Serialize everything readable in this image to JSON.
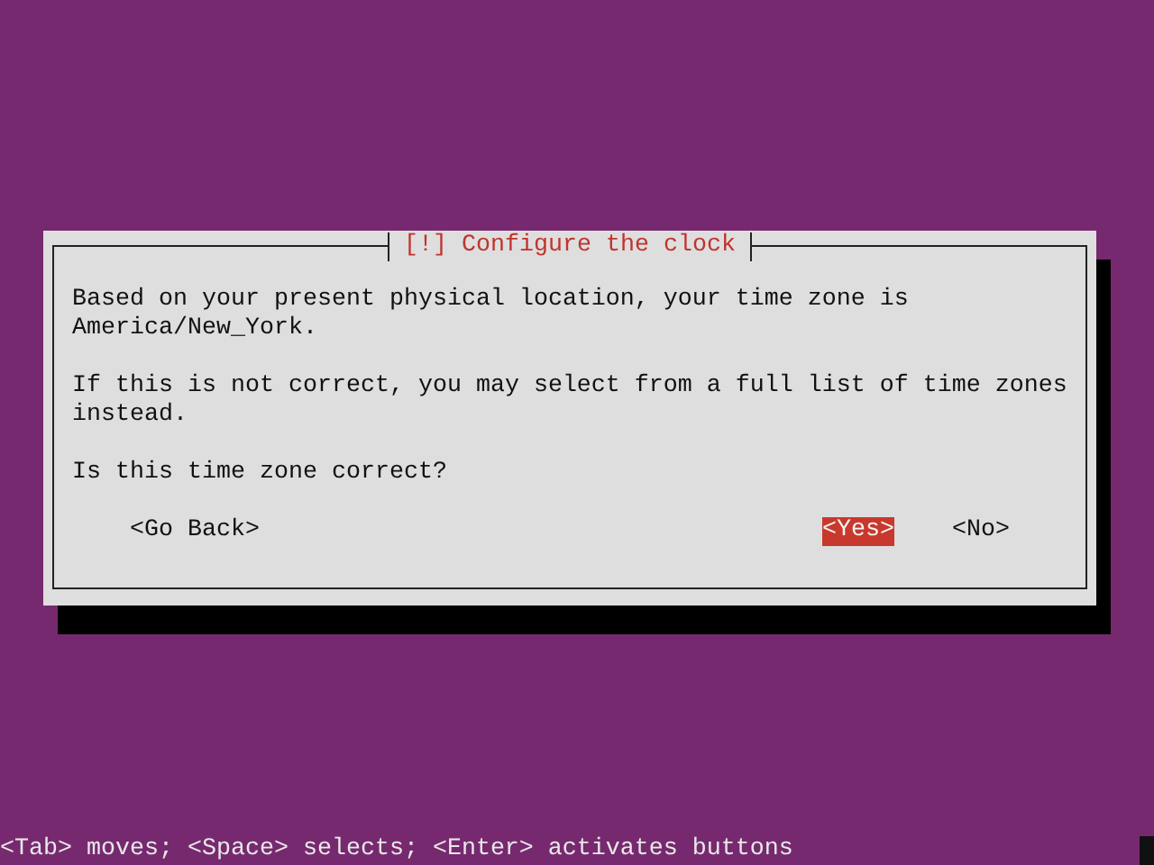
{
  "dialog": {
    "title": "[!] Configure the clock",
    "paragraphs": [
      "Based on your present physical location, your time zone is\nAmerica/New_York.",
      "If this is not correct, you may select from a full list of time zones\ninstead.",
      "Is this time zone correct?"
    ],
    "buttons": [
      {
        "label": "<Go Back>",
        "selected": false
      },
      {
        "label": "<Yes>",
        "selected": true
      },
      {
        "label": "<No>",
        "selected": false
      }
    ]
  },
  "status_bar": "<Tab> moves; <Space> selects; <Enter> activates buttons"
}
